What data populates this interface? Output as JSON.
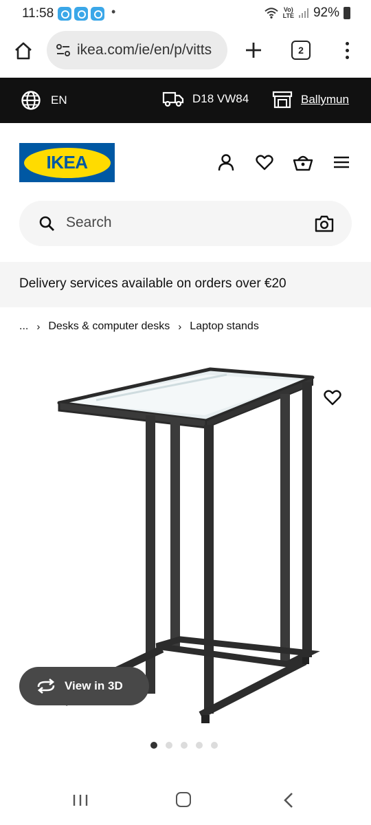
{
  "status_bar": {
    "time": "11:58",
    "dot": "•",
    "volte_top": "Vo)",
    "volte_bottom": "LTE",
    "battery": "92%"
  },
  "browser": {
    "url": "ikea.com/ie/en/p/vitts",
    "tab_count": "2"
  },
  "info_bar": {
    "language": "EN",
    "postcode": "D18 VW84",
    "store": "Ballymun"
  },
  "header": {
    "logo_text": "IKEA",
    "brand_blue": "#0058a3",
    "brand_yellow": "#ffdb00"
  },
  "search": {
    "placeholder": "Search"
  },
  "banner": {
    "text": "Delivery services available on orders over €20"
  },
  "breadcrumb": {
    "items": [
      "...",
      "Desks & computer desks",
      "Laptop stands"
    ]
  },
  "product": {
    "view3d_label": "View in 3D",
    "image_count": 5,
    "active_image": 1
  },
  "icons": {
    "home": "home-icon",
    "tune": "tune-icon",
    "add": "plus-icon",
    "menu": "more-vert-icon",
    "globe": "globe-icon",
    "truck": "truck-icon",
    "store": "store-icon",
    "profile": "person-icon",
    "wishlist": "heart-icon",
    "basket": "basket-icon",
    "hamburger": "menu-icon",
    "search": "search-icon",
    "camera": "camera-icon",
    "rotate": "rotate-3d-icon"
  }
}
